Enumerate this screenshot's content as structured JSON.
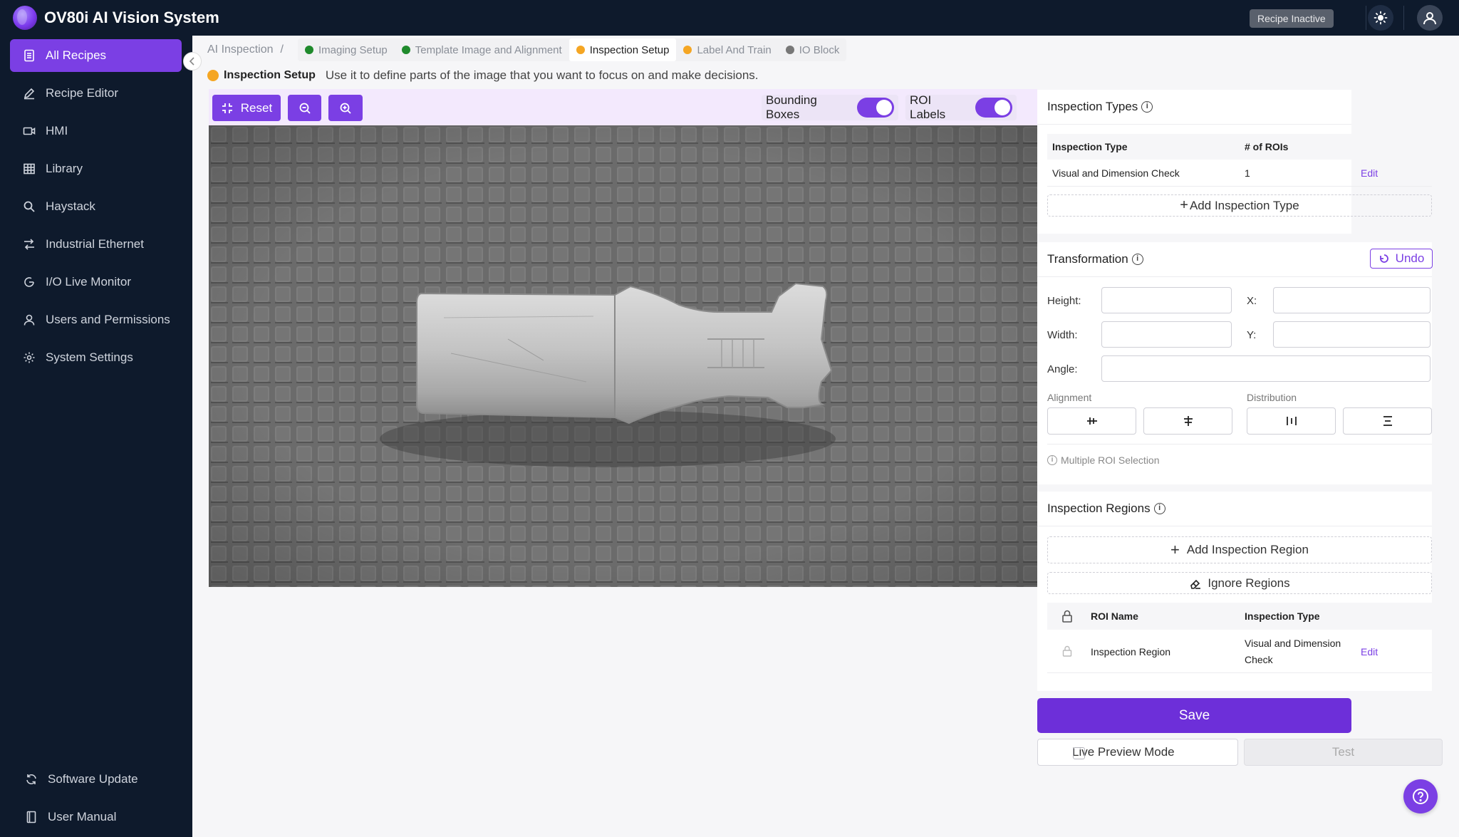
{
  "app": {
    "title": "OV80i AI Vision System",
    "status_chip": "Recipe Inactive"
  },
  "sidebar": {
    "items": [
      {
        "label": "All Recipes",
        "icon": "document-icon",
        "active": true
      },
      {
        "label": "Recipe Editor",
        "icon": "pencil-icon"
      },
      {
        "label": "HMI",
        "icon": "video-icon"
      },
      {
        "label": "Library",
        "icon": "grid-icon"
      },
      {
        "label": "Haystack",
        "icon": "search-icon"
      },
      {
        "label": "Industrial Ethernet",
        "icon": "network-icon"
      },
      {
        "label": "I/O Live Monitor",
        "icon": "gauge-icon"
      },
      {
        "label": "Users and Permissions",
        "icon": "user-icon"
      },
      {
        "label": "System Settings",
        "icon": "gear-icon"
      }
    ],
    "footer": [
      {
        "label": "Software Update",
        "icon": "refresh-icon"
      },
      {
        "label": "User Manual",
        "icon": "book-icon"
      }
    ]
  },
  "breadcrumb": {
    "root": "AI Inspection",
    "separator": "/"
  },
  "steps": [
    {
      "label": "Imaging Setup",
      "color": "#1f8a2c"
    },
    {
      "label": "Template Image and Alignment",
      "color": "#1f8a2c"
    },
    {
      "label": "Inspection Setup",
      "color": "#f5a623",
      "active": true
    },
    {
      "label": "Label And Train",
      "color": "#f5a623"
    },
    {
      "label": "IO Block",
      "color": "#777777"
    }
  ],
  "subheader": {
    "label": "Inspection Setup",
    "text": "Use it to define parts of the image that you want to focus on and make decisions."
  },
  "toolbar": {
    "reset_label": "Reset",
    "bounding_boxes_label": "Bounding Boxes",
    "roi_labels_label": "ROI Labels",
    "bounding_boxes_on": true,
    "roi_labels_on": true
  },
  "inspection_types": {
    "title": "Inspection Types",
    "columns": [
      "Inspection Type",
      "# of ROIs"
    ],
    "rows": [
      {
        "type": "Visual and Dimension Check",
        "rois": "1",
        "action": "Edit"
      }
    ],
    "add_label": "Add Inspection Type"
  },
  "transformation": {
    "title": "Transformation",
    "undo_label": "Undo",
    "fields": {
      "height": "Height:",
      "x": "X:",
      "width": "Width:",
      "y": "Y:",
      "angle": "Angle:"
    },
    "values": {
      "height": "",
      "x": "",
      "width": "",
      "y": "",
      "angle": ""
    },
    "alignment_label": "Alignment",
    "distribution_label": "Distribution",
    "multi_roi_label": "Multiple ROI Selection"
  },
  "inspection_regions": {
    "title": "Inspection Regions",
    "add_label": "Add Inspection Region",
    "ignore_label": "Ignore Regions",
    "columns": [
      "ROI Name",
      "Inspection Type"
    ],
    "rows": [
      {
        "name": "Inspection Region",
        "type_line1": "Visual and Dimension",
        "type_line2": "Check",
        "action": "Edit"
      }
    ]
  },
  "actions": {
    "save_label": "Save",
    "live_preview_label": "Live Preview Mode",
    "live_preview_checked": false,
    "test_label": "Test"
  },
  "colors": {
    "accent": "#7b3fe4",
    "sidebar_bg": "#0e1a2c",
    "success": "#1f8a2c",
    "warning": "#f5a623"
  }
}
